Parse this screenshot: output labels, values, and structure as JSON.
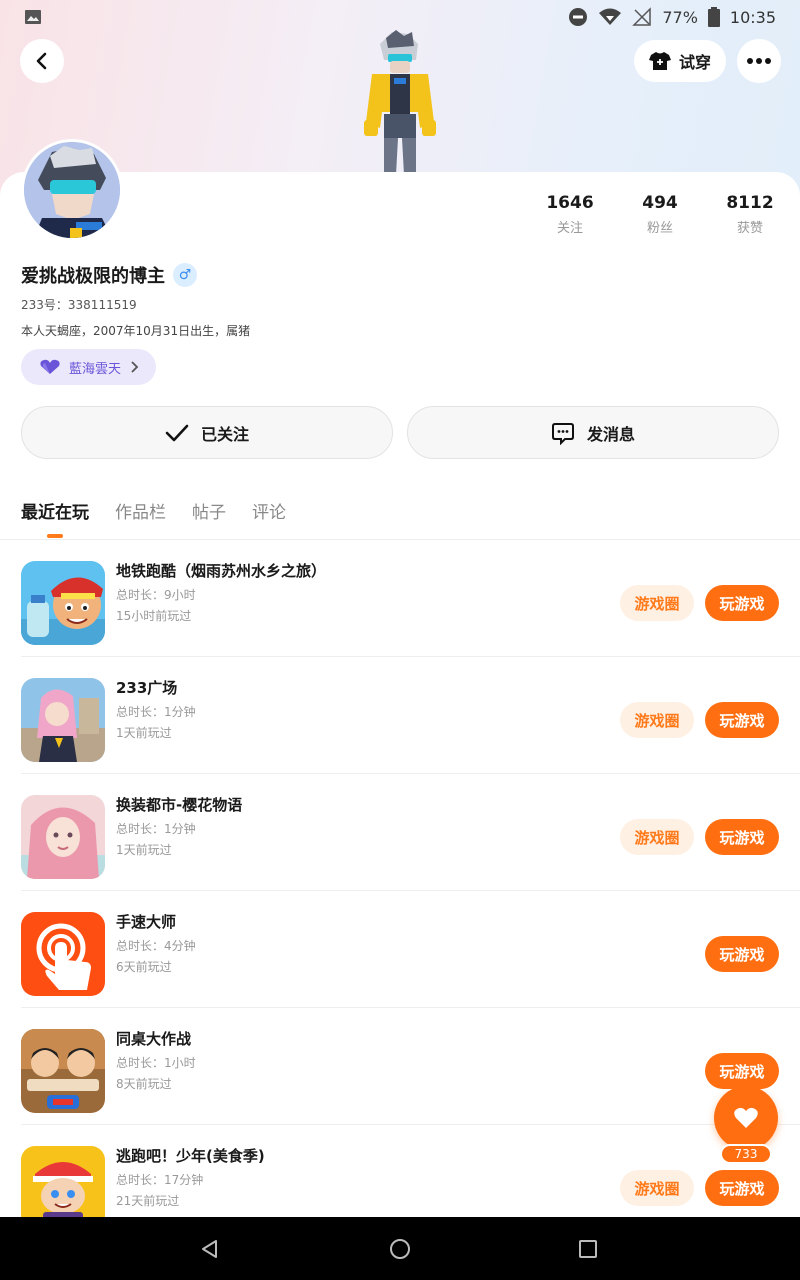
{
  "status_bar": {
    "battery": "77%",
    "time": "10:35"
  },
  "header": {
    "back_icon": "back-chevron-icon",
    "try_on_label": "试穿",
    "more_icon": "more-dots-icon"
  },
  "profile": {
    "name": "爱挑战极限的博主",
    "gender_symbol": "♂",
    "id_line": "233号：338111519",
    "bio": "本人天蝎座，2007年10月31日出生，属猪",
    "tag": "藍海雲天"
  },
  "stats": [
    {
      "value": "1646",
      "label": "关注"
    },
    {
      "value": "494",
      "label": "粉丝"
    },
    {
      "value": "8112",
      "label": "获赞"
    }
  ],
  "actions": {
    "follow_label": "已关注",
    "message_label": "发消息"
  },
  "tabs": [
    "最近在玩",
    "作品栏",
    "帖子",
    "评论"
  ],
  "game_buttons": {
    "circle": "游戏圈",
    "play": "玩游戏"
  },
  "games": [
    {
      "title": "地铁跑酷（烟雨苏州水乡之旅）",
      "duration": "总时长：9小时",
      "last_played": "15小时前玩过",
      "has_circle": true
    },
    {
      "title": "233广场",
      "duration": "总时长：1分钟",
      "last_played": "1天前玩过",
      "has_circle": true
    },
    {
      "title": "换装都市-樱花物语",
      "duration": "总时长：1分钟",
      "last_played": "1天前玩过",
      "has_circle": true
    },
    {
      "title": "手速大师",
      "duration": "总时长：4分钟",
      "last_played": "6天前玩过",
      "has_circle": false
    },
    {
      "title": "同桌大作战",
      "duration": "总时长：1小时",
      "last_played": "8天前玩过",
      "has_circle": false
    },
    {
      "title": "逃跑吧！少年(美食季)",
      "duration": "总时长：17分钟",
      "last_played": "21天前玩过",
      "has_circle": true
    }
  ],
  "fab": {
    "count": "733"
  },
  "colors": {
    "accent": "#ff6f12",
    "accent_light": "#fff0e4",
    "tag_bg": "#ebe8fb",
    "tag_text": "#6a55d8"
  }
}
